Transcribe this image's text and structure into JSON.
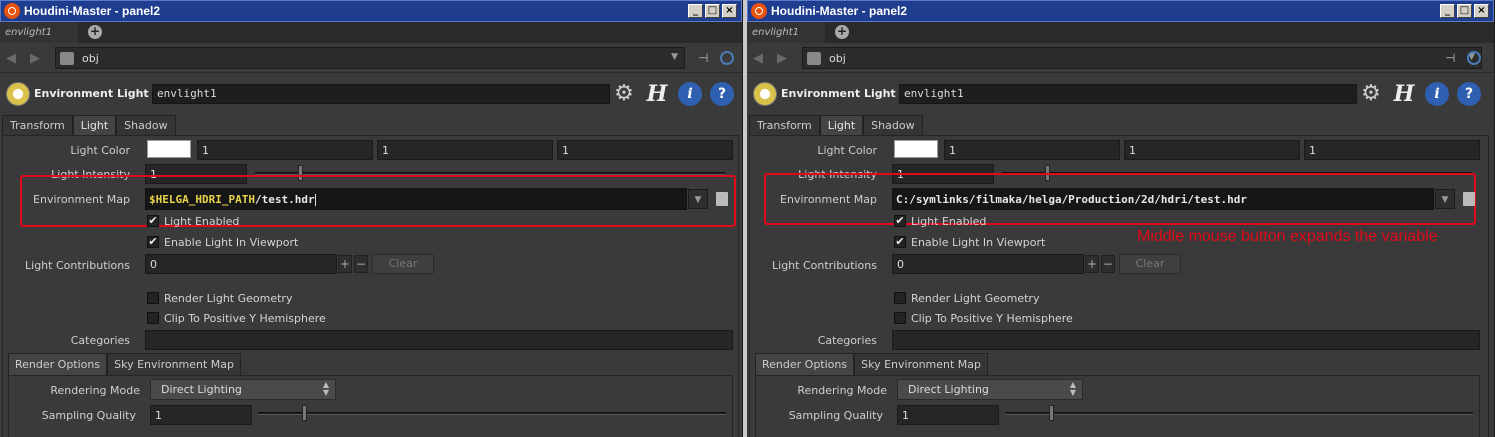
{
  "panels": [
    {
      "window_title": "Houdini-Master - panel2",
      "node_tab": "envlight1",
      "path": "obj",
      "node_type": "Environment Light",
      "node_name": "envlight1",
      "tabs": [
        "Transform",
        "Light",
        "Shadow"
      ],
      "labels": {
        "light_color": "Light Color",
        "light_intensity": "Light Intensity",
        "environment_map": "Environment Map",
        "light_contributions": "Light Contributions",
        "categories": "Categories"
      },
      "color": [
        "1",
        "1",
        "1"
      ],
      "intensity": "1",
      "env_map_var": "$HELGA_HDRI_PATH",
      "env_map_rest": "/test.hdr",
      "env_map_full": "",
      "checks": {
        "light_enabled": "Light Enabled",
        "enable_in_viewport": "Enable Light In Viewport",
        "render_geometry": "Render Light Geometry",
        "clip_hemisphere": "Clip To Positive Y Hemisphere"
      },
      "contributions": "0",
      "clear_label": "Clear",
      "subtabs": [
        "Render Options",
        "Sky Environment Map"
      ],
      "rendering_mode_label": "Rendering Mode",
      "rendering_mode": "Direct Lighting",
      "sampling_quality_label": "Sampling Quality",
      "sampling_quality": "1",
      "annotation": ""
    },
    {
      "window_title": "Houdini-Master - panel2",
      "node_tab": "envlight1",
      "path": "obj",
      "node_type": "Environment Light",
      "node_name": "envlight1",
      "tabs": [
        "Transform",
        "Light",
        "Shadow"
      ],
      "labels": {
        "light_color": "Light Color",
        "light_intensity": "Light Intensity",
        "environment_map": "Environment Map",
        "light_contributions": "Light Contributions",
        "categories": "Categories"
      },
      "color": [
        "1",
        "1",
        "1"
      ],
      "intensity": "1",
      "env_map_var": "",
      "env_map_rest": "",
      "env_map_full": "C:/symlinks/filmaka/helga/Production/2d/hdri/test.hdr",
      "checks": {
        "light_enabled": "Light Enabled",
        "enable_in_viewport": "Enable Light In Viewport",
        "render_geometry": "Render Light Geometry",
        "clip_hemisphere": "Clip To Positive Y Hemisphere"
      },
      "contributions": "0",
      "clear_label": "Clear",
      "subtabs": [
        "Render Options",
        "Sky Environment Map"
      ],
      "rendering_mode_label": "Rendering Mode",
      "rendering_mode": "Direct Lighting",
      "sampling_quality_label": "Sampling Quality",
      "sampling_quality": "1",
      "annotation": "Middle mouse button expands the variable"
    }
  ],
  "colors": {
    "title_bar": "#1f3d8f",
    "highlight": "#e3081a",
    "variable": "#e8d44a"
  }
}
